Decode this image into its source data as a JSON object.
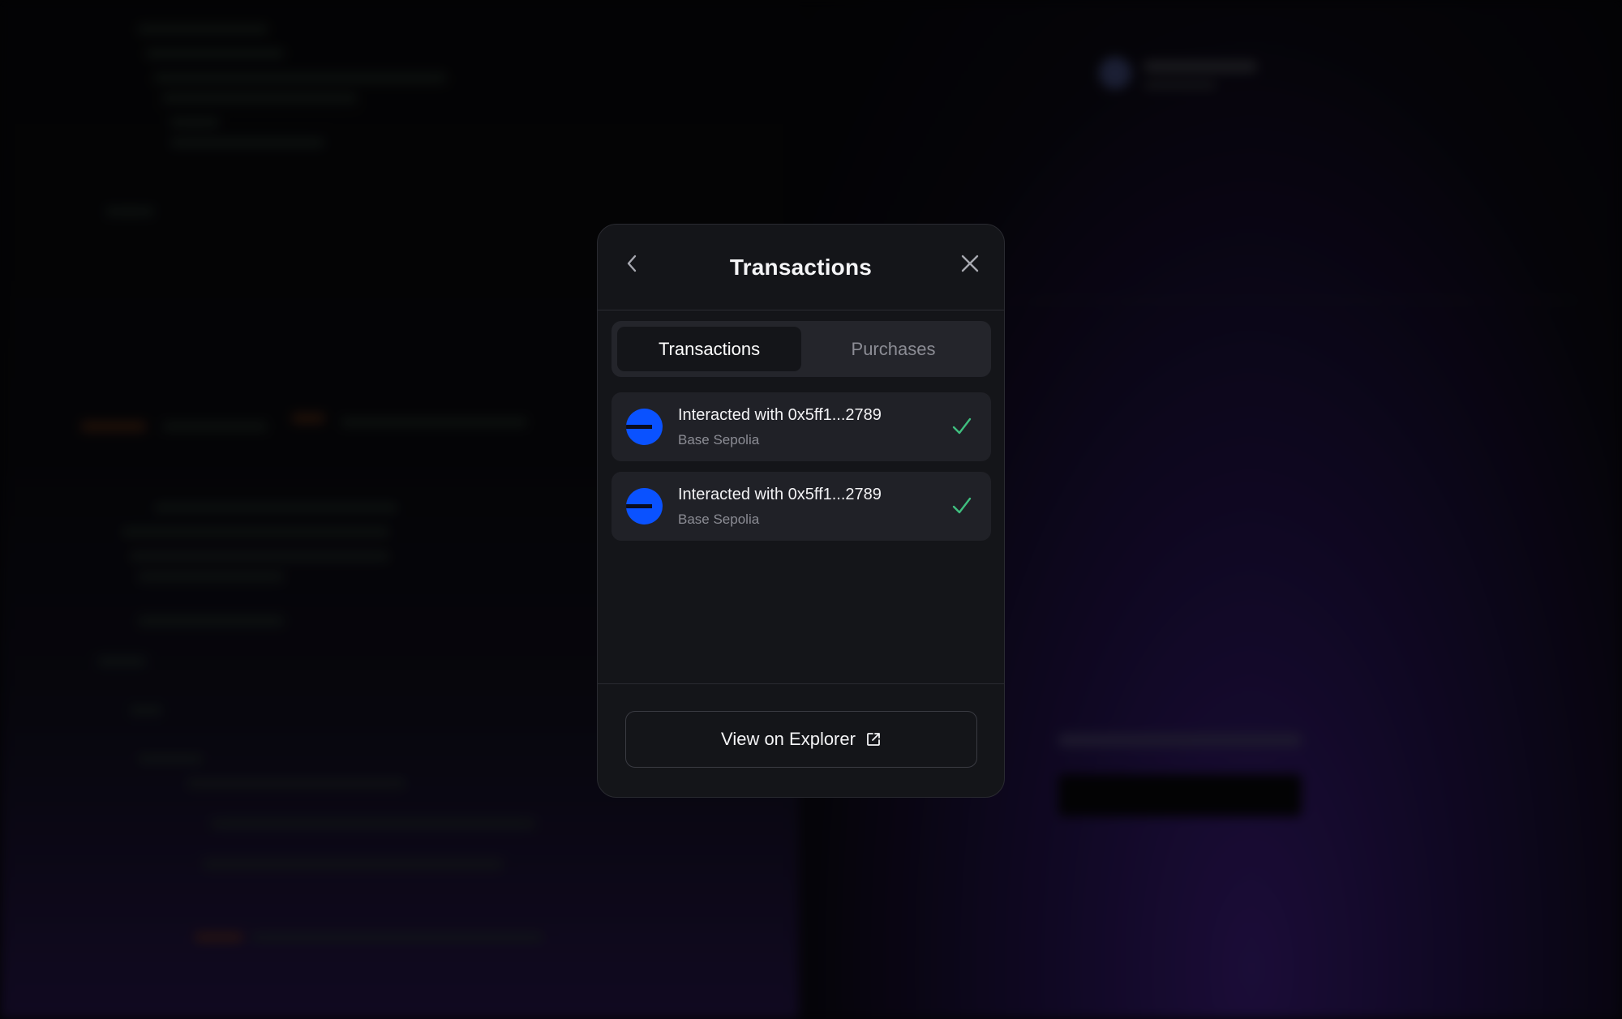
{
  "modal": {
    "title": "Transactions",
    "tabs": [
      {
        "label": "Transactions",
        "active": true
      },
      {
        "label": "Purchases",
        "active": false
      }
    ],
    "transactions": [
      {
        "title": "Interacted with 0x5ff1...2789",
        "network": "Base Sepolia",
        "status": "success",
        "icon": "base-network-icon"
      },
      {
        "title": "Interacted with 0x5ff1...2789",
        "network": "Base Sepolia",
        "status": "success",
        "icon": "base-network-icon"
      }
    ],
    "footer": {
      "explorer_label": "View on Explorer",
      "explorer_icon": "external-link-icon"
    }
  },
  "colors": {
    "modal_bg": "#141519",
    "tabs_bg": "#24252b",
    "item_bg": "#202127",
    "base_blue": "#0a52ff",
    "success_green": "#3fbf7f",
    "muted_text": "#8c8d95"
  }
}
